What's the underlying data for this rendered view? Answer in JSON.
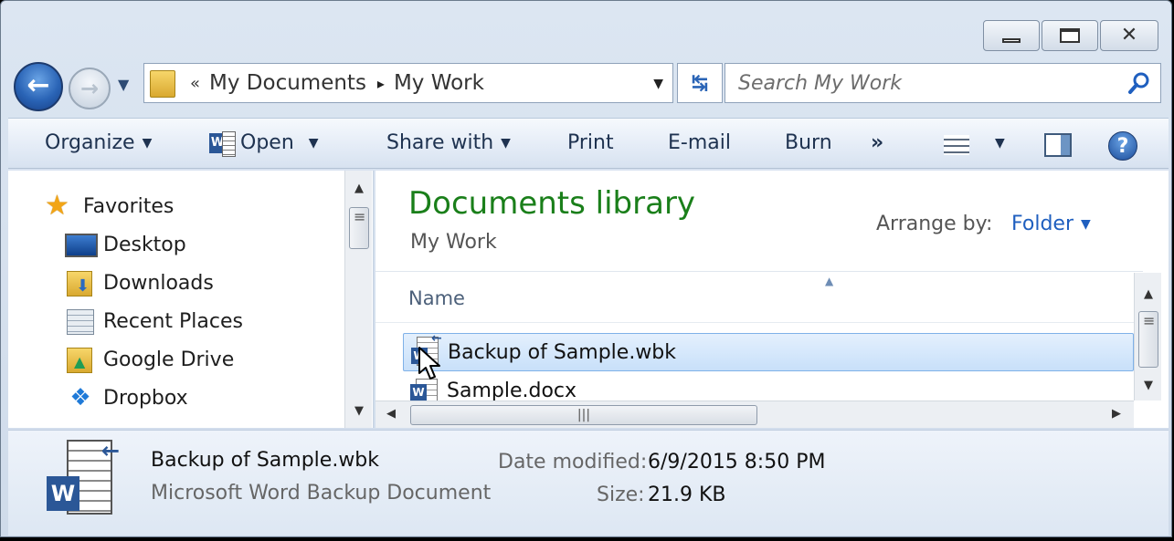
{
  "address": {
    "recent_sep": "«",
    "crumbs": [
      "My Documents",
      "My Work"
    ],
    "crumb_sep": "▸"
  },
  "search": {
    "placeholder": "Search My Work"
  },
  "toolbar": {
    "organize": "Organize",
    "open": "Open",
    "share_with": "Share with",
    "print": "Print",
    "email": "E-mail",
    "burn": "Burn",
    "more": "»"
  },
  "nav_pane": {
    "favorites": "Favorites",
    "items": [
      "Desktop",
      "Downloads",
      "Recent Places",
      "Google Drive",
      "Dropbox"
    ]
  },
  "library": {
    "title": "Documents library",
    "subtitle": "My Work",
    "arrange_label": "Arrange by:",
    "arrange_value": "Folder"
  },
  "file_list": {
    "column_name": "Name",
    "files": [
      {
        "name": "Backup of Sample.wbk",
        "selected": true
      },
      {
        "name": "Sample.docx",
        "selected": false
      }
    ]
  },
  "details": {
    "name": "Backup of Sample.wbk",
    "type": "Microsoft Word Backup Document",
    "date_label": "Date modified:",
    "date_value": "6/9/2015 8:50 PM",
    "size_label": "Size:",
    "size_value": "21.9 KB"
  },
  "colors": {
    "library_title": "#1a7f1a",
    "link_blue": "#1f5fbf",
    "selection": "#c8e0fa"
  },
  "icons": [
    "back-icon",
    "forward-icon",
    "folder-icon",
    "refresh-icon",
    "search-icon",
    "word-icon",
    "view-icon",
    "preview-pane-icon",
    "help-icon",
    "star-icon",
    "desktop-icon",
    "downloads-icon",
    "recent-places-icon",
    "google-drive-icon",
    "dropbox-icon"
  ]
}
